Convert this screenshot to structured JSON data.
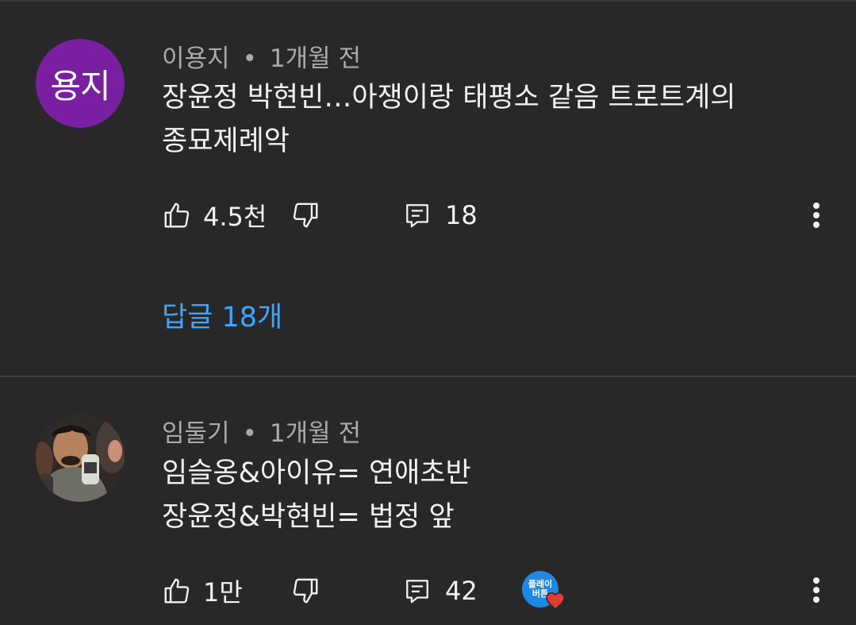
{
  "comments": [
    {
      "avatar_text": "용지",
      "author": "이용지",
      "separator": "•",
      "time": "1개월 전",
      "lines": [
        "장윤정 박현빈…아쟁이랑 태평소 같음 트로트계의",
        "종묘제례악"
      ],
      "likes": "4.5천",
      "replies": "18",
      "replies_link": "답글 18개",
      "avatar_color": "#7b1fa2"
    },
    {
      "author": "임둘기",
      "separator": "•",
      "time": "1개월 전",
      "lines": [
        "임슬옹&아이유= 연애초반",
        "장윤정&박현빈= 법정 앞"
      ],
      "likes": "1만",
      "replies": "42",
      "creator_badge": [
        "플레이",
        "버튼"
      ]
    }
  ],
  "colors": {
    "background": "#282828",
    "link": "#3ea6ff",
    "heart": "#e53935"
  }
}
